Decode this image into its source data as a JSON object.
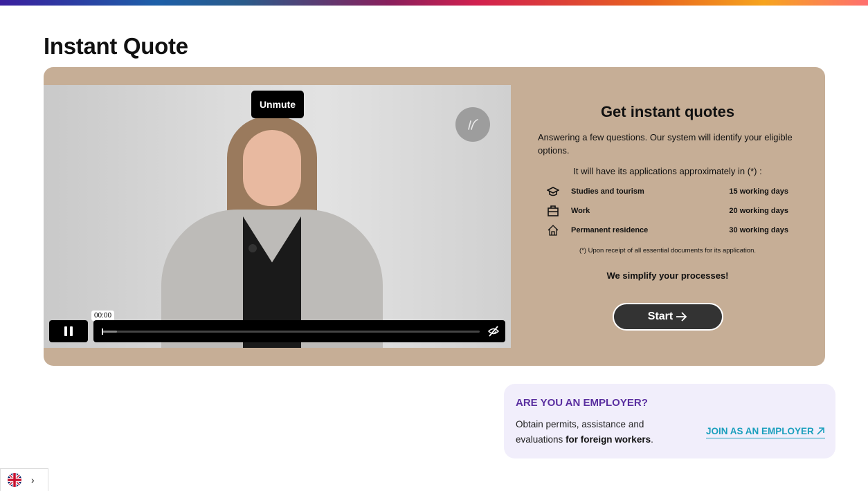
{
  "page": {
    "title": "Instant Quote"
  },
  "video": {
    "unmute_label": "Unmute",
    "time": "00:00",
    "progress": 0.04,
    "icons": {
      "pause": "pause-icon",
      "captions": "captions-off-icon",
      "logo": "brand-logo-icon"
    }
  },
  "quote": {
    "title": "Get instant quotes",
    "description": "Answering a few questions. Our system will identify your eligible options.",
    "subtitle": "It will have its applications approximately in (*) :",
    "items": [
      {
        "icon": "graduation-cap-icon",
        "label": "Studies and tourism",
        "days": "15 working days"
      },
      {
        "icon": "briefcase-icon",
        "label": "Work",
        "days": "20 working days"
      },
      {
        "icon": "home-icon",
        "label": "Permanent residence",
        "days": "30 working days"
      }
    ],
    "note": "(*) Upon receipt of all essential documents for its application.",
    "tagline": "We simplify your processes!",
    "start_label": "Start"
  },
  "employer": {
    "title": "ARE YOU AN EMPLOYER?",
    "text_plain": "Obtain permits, assistance and evaluations ",
    "text_bold": "for foreign workers",
    "text_end": ".",
    "link_label": "JOIN AS AN EMPLOYER"
  },
  "language": {
    "flag": "uk-flag-icon",
    "chevron": "chevron-right-icon"
  },
  "colors": {
    "card_bg": "#c6ae96",
    "employer_bg": "#f1eefb",
    "employer_title": "#5a2fa0",
    "link": "#1a9fbd",
    "button": "#333333"
  }
}
